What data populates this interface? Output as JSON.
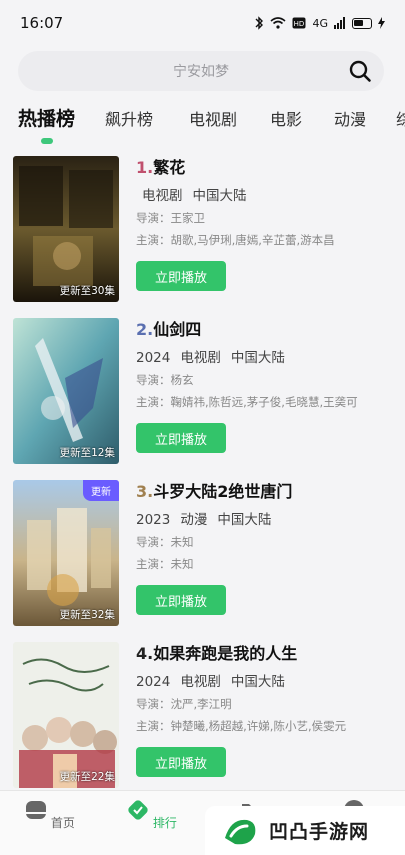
{
  "status_bar": {
    "time": "16:07",
    "signal_text": "4G"
  },
  "search": {
    "placeholder": "宁安如梦"
  },
  "tabs": [
    {
      "label": "热播榜",
      "active": true
    },
    {
      "label": "飙升榜"
    },
    {
      "label": "电视剧"
    },
    {
      "label": "电影"
    },
    {
      "label": "动漫"
    },
    {
      "label": "综"
    }
  ],
  "items": [
    {
      "rank": "1.",
      "rank_color": "#c0506e",
      "title": "繁花",
      "year": "",
      "type": "电视剧",
      "region": "中国大陆",
      "director": "导演：王家卫",
      "cast": "主演：胡歌,马伊琍,唐嫣,辛芷蕾,游本昌",
      "episode": "更新至30集",
      "badge": "",
      "play": "立即播放"
    },
    {
      "rank": "2.",
      "rank_color": "#5a6fb0",
      "title": "仙剑四",
      "year": "2024",
      "type": "电视剧",
      "region": "中国大陆",
      "director": "导演：杨玄",
      "cast": "主演：鞠婧祎,陈哲远,茅子俊,毛晓慧,王䶮可",
      "episode": "更新至12集",
      "badge": "",
      "play": "立即播放"
    },
    {
      "rank": "3.",
      "rank_color": "#a08050",
      "title": "斗罗大陆2绝世唐门",
      "year": "2023",
      "type": "动漫",
      "region": "中国大陆",
      "director": "导演：未知",
      "cast": "主演：未知",
      "episode": "更新至32集",
      "badge": "更新",
      "play": "立即播放"
    },
    {
      "rank": "4.",
      "rank_color": "#222222",
      "title": "如果奔跑是我的人生",
      "year": "2024",
      "type": "电视剧",
      "region": "中国大陆",
      "director": "导演：沈严,李江明",
      "cast": "主演：钟楚曦,杨超越,许娣,陈小艺,侯雯元",
      "episode": "更新至22集",
      "badge": "",
      "play": "立即播放"
    }
  ],
  "bottom_nav": [
    {
      "label": "首页",
      "icon": "home-icon"
    },
    {
      "label": "排行",
      "icon": "ranking-icon",
      "active": true
    },
    {
      "label": "",
      "icon": "folder-icon"
    },
    {
      "label": "",
      "icon": "user-icon"
    }
  ],
  "watermark": {
    "text": "凹凸手游网"
  },
  "colors": {
    "accent": "#33c46a",
    "badge": "#6a5cff"
  }
}
